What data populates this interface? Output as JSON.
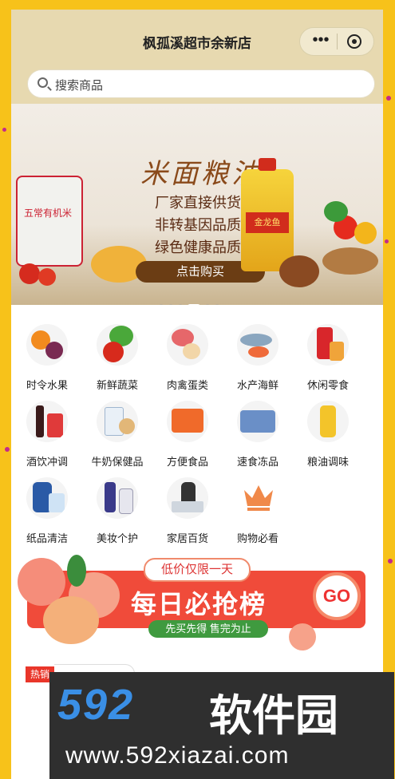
{
  "app": {
    "title": "枫孤溪超市余新店"
  },
  "capsule": {
    "more_glyph": "•••"
  },
  "search": {
    "placeholder": "搜索商品"
  },
  "banner": {
    "heading": "米面粮油",
    "lines": [
      "厂家直接供货",
      "非转基因品质",
      "绿色健康品质"
    ],
    "cta": "点击购买",
    "bag_text": "五常有机米",
    "bottle_text": "金龙鱼"
  },
  "categories": [
    {
      "label": "时令水果"
    },
    {
      "label": "新鲜蔬菜"
    },
    {
      "label": "肉禽蛋类"
    },
    {
      "label": "水产海鲜"
    },
    {
      "label": "休闲零食"
    },
    {
      "label": "酒饮冲调"
    },
    {
      "label": "牛奶保健品"
    },
    {
      "label": "方便食品"
    },
    {
      "label": "速食冻品"
    },
    {
      "label": "粮油调味"
    },
    {
      "label": "纸品清洁"
    },
    {
      "label": "美妆个护"
    },
    {
      "label": "家居百货"
    },
    {
      "label": "购物必看"
    }
  ],
  "promo": {
    "tag": "低价仅限一天",
    "title": "每日必抢榜",
    "subtitle": "先买先得 售完为止",
    "go": "GO"
  },
  "hot": {
    "label": "热销"
  },
  "watermark": {
    "brand_digits": "592",
    "brand_text": "软件园",
    "url": "www.592xiazai.com"
  },
  "colors": {
    "accent": "#f04b3a",
    "header": "#e7d9b0",
    "frame": "#f7c21a"
  }
}
